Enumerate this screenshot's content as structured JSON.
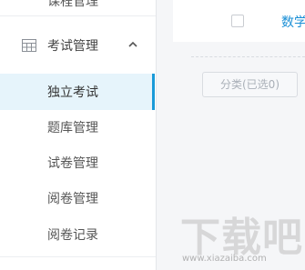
{
  "sidebar": {
    "prev_item_label": "课程管理",
    "group": {
      "label": "考试管理",
      "icon": "grid-table-icon",
      "expanded": true
    },
    "items": [
      {
        "label": "独立考试",
        "active": true
      },
      {
        "label": "题库管理",
        "active": false
      },
      {
        "label": "试卷管理",
        "active": false
      },
      {
        "label": "阅卷管理",
        "active": false
      },
      {
        "label": "阅卷记录",
        "active": false
      }
    ]
  },
  "main": {
    "table_header": {
      "column_label": "数学"
    },
    "category_button_label": "分类(已选0)"
  },
  "watermark": {
    "text": "下载吧",
    "url": "www.xiazaiba.com"
  },
  "colors": {
    "accent": "#1a9ad8",
    "active_bg": "#e6f4fb",
    "link": "#1a8fd6"
  }
}
